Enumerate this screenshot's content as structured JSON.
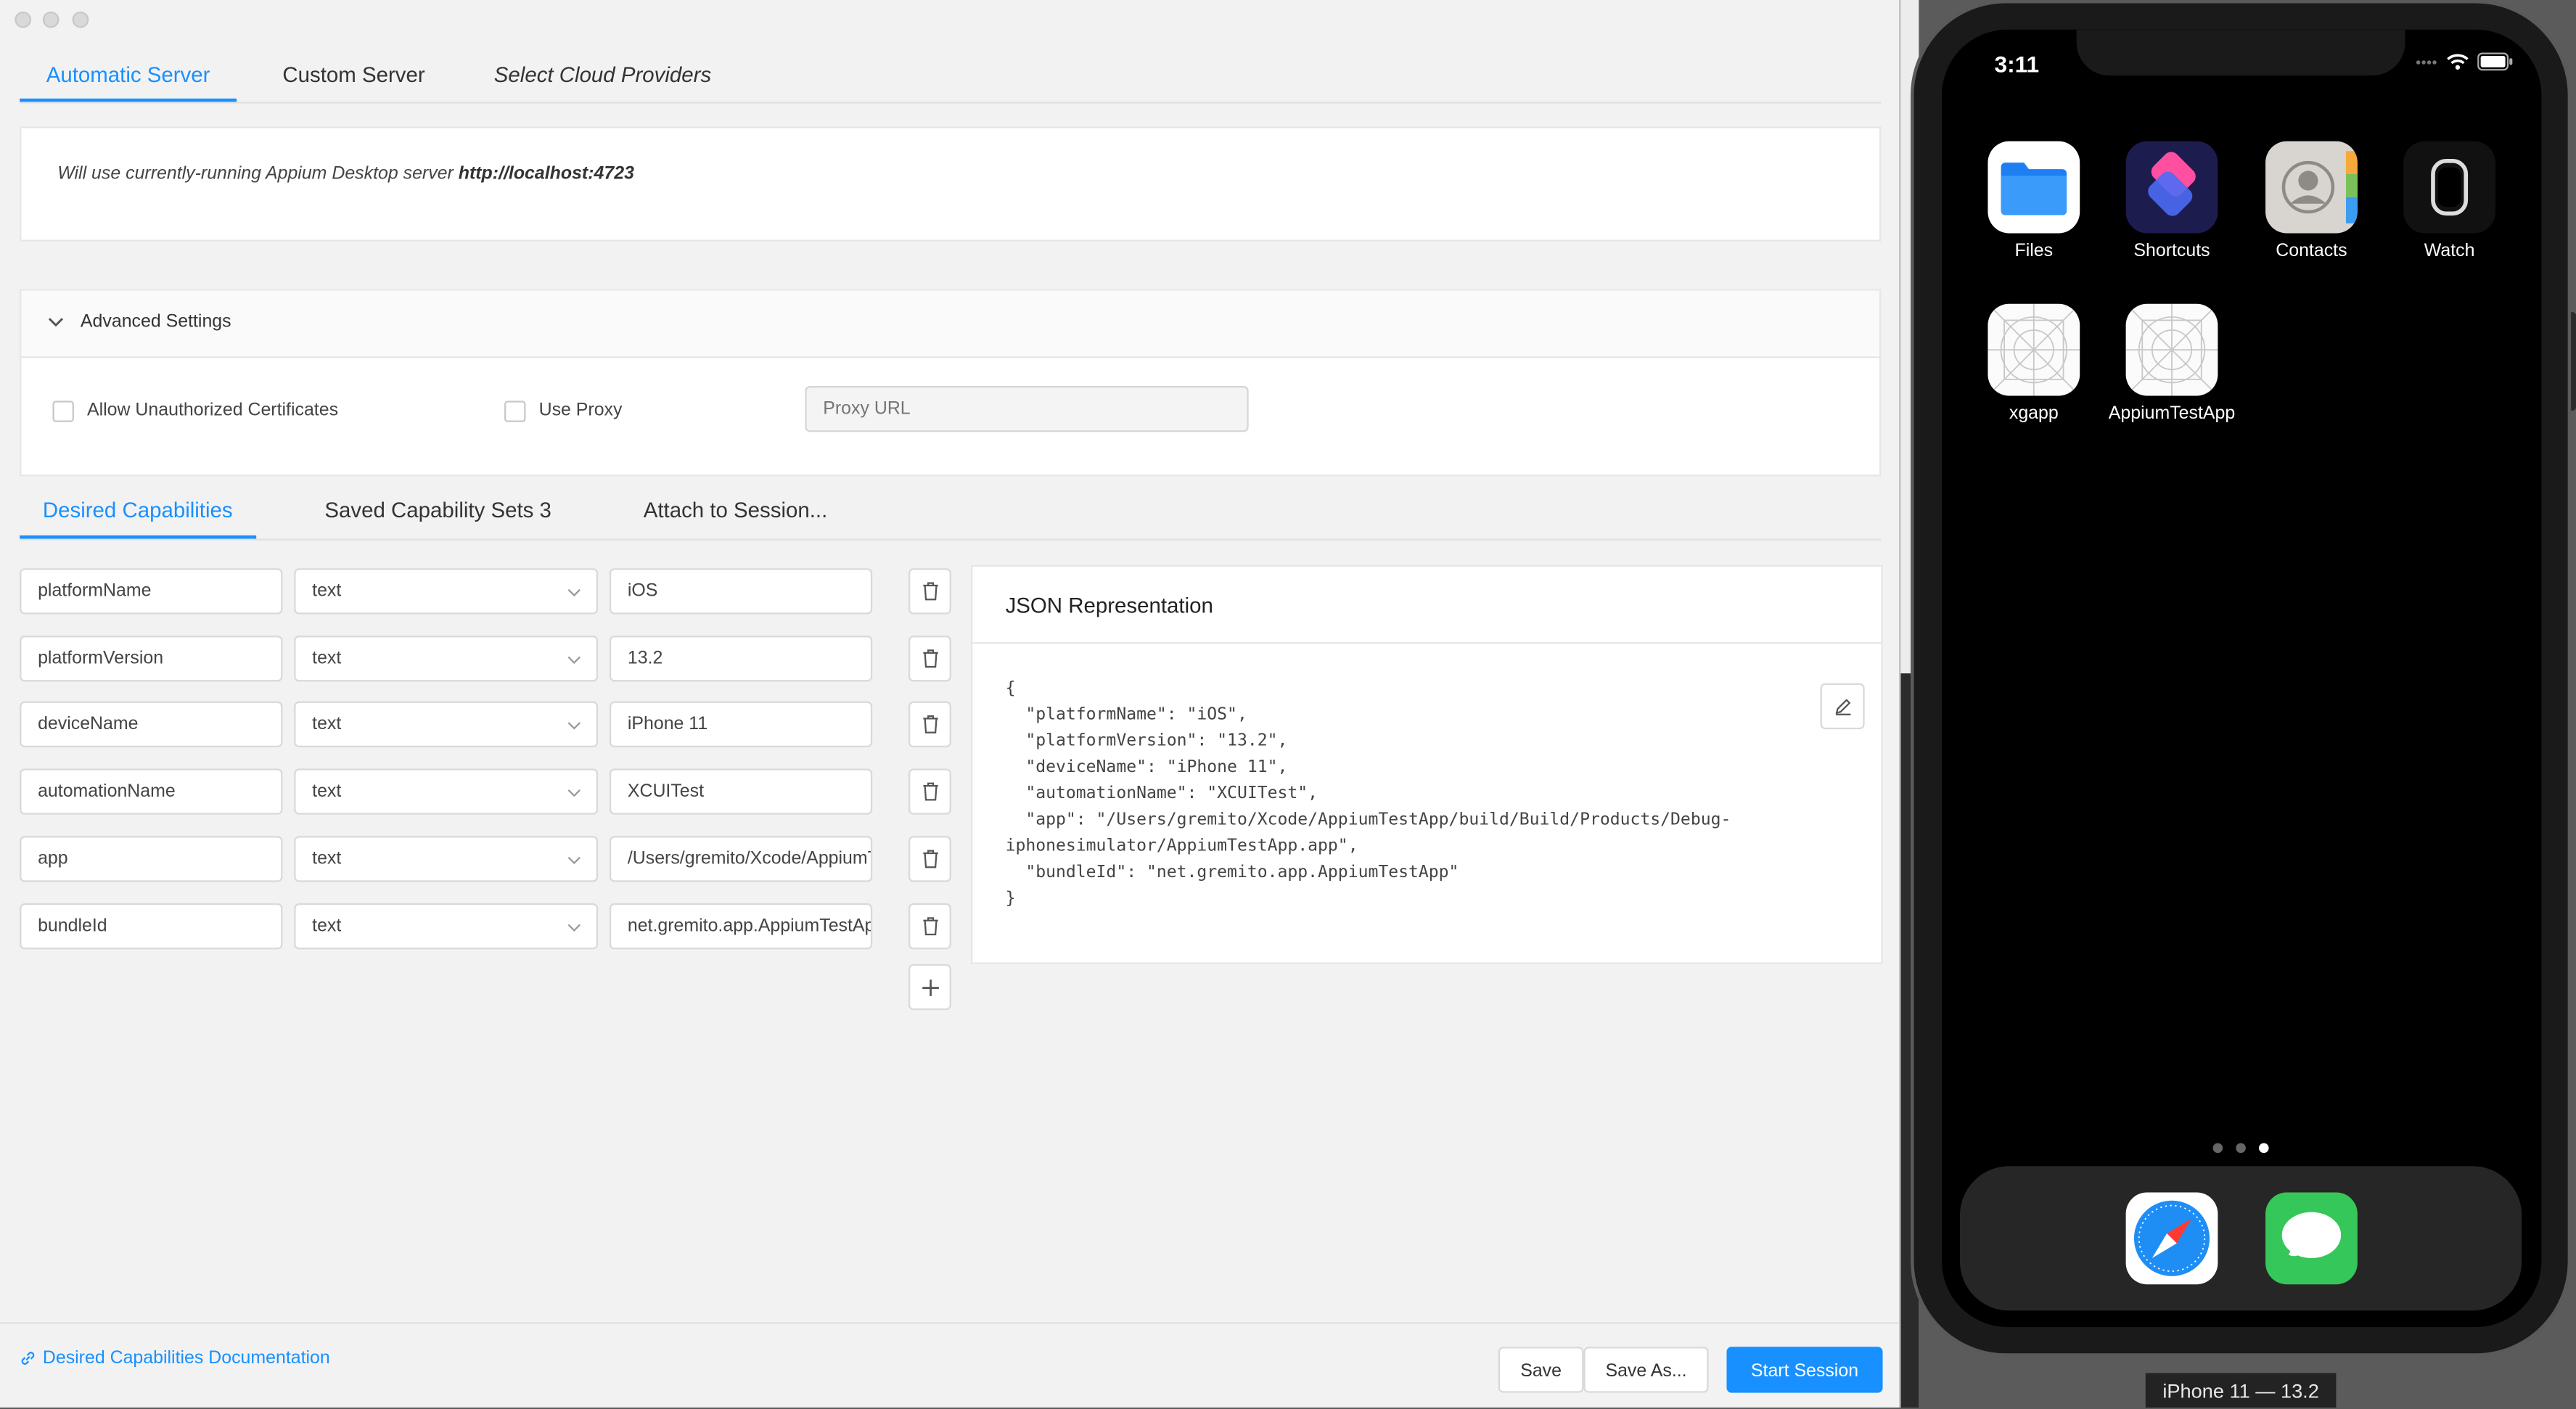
{
  "server_tabs": [
    {
      "label": "Automatic Server",
      "active": true
    },
    {
      "label": "Custom Server",
      "active": false
    },
    {
      "label": "Select Cloud Providers",
      "active": false
    }
  ],
  "server": {
    "prefix": "Will use currently-running Appium Desktop server",
    "url": "http://localhost:4723"
  },
  "advanced": {
    "title": "Advanced Settings",
    "allow_unauthorized": "Allow Unauthorized Certificates",
    "use_proxy": "Use Proxy",
    "proxy_placeholder": "Proxy URL"
  },
  "cap_tabs": [
    {
      "label": "Desired Capabilities",
      "active": true
    },
    {
      "label": "Saved Capability Sets 3",
      "active": false
    },
    {
      "label": "Attach to Session...",
      "active": false
    }
  ],
  "capabilities": [
    {
      "name": "platformName",
      "type": "text",
      "value": "iOS"
    },
    {
      "name": "platformVersion",
      "type": "text",
      "value": "13.2"
    },
    {
      "name": "deviceName",
      "type": "text",
      "value": "iPhone 11"
    },
    {
      "name": "automationName",
      "type": "text",
      "value": "XCUITest"
    },
    {
      "name": "app",
      "type": "text",
      "value": "/Users/gremito/Xcode/AppiumTestApp/build/Build/Products/Debug-iphonesimulator/AppiumTestApp.app"
    },
    {
      "name": "bundleId",
      "type": "text",
      "value": "net.gremito.app.AppiumTestApp"
    }
  ],
  "json_panel": {
    "title": "JSON Representation",
    "content": "{\n  \"platformName\": \"iOS\",\n  \"platformVersion\": \"13.2\",\n  \"deviceName\": \"iPhone 11\",\n  \"automationName\": \"XCUITest\",\n  \"app\": \"/Users/gremito/Xcode/AppiumTestApp/build/Build/Products/Debug-\niphonesimulator/AppiumTestApp.app\",\n  \"bundleId\": \"net.gremito.app.AppiumTestApp\"\n}"
  },
  "footer": {
    "docs_link": "Desired Capabilities Documentation",
    "save": "Save",
    "save_as": "Save As...",
    "start": "Start Session"
  },
  "colors": {
    "accent": "#1890ff"
  },
  "simulator": {
    "time": "3:11",
    "caption": "iPhone 11 — 13.2",
    "apps": [
      {
        "label": "Files",
        "icon": "files-icon"
      },
      {
        "label": "Shortcuts",
        "icon": "shortcuts-icon"
      },
      {
        "label": "Contacts",
        "icon": "contacts-icon"
      },
      {
        "label": "Watch",
        "icon": "watch-icon"
      },
      {
        "label": "xgapp",
        "icon": "placeholder-app-icon"
      },
      {
        "label": "AppiumTestApp",
        "icon": "placeholder-app-icon"
      }
    ],
    "dock": [
      {
        "icon": "safari-icon"
      },
      {
        "icon": "messages-icon"
      }
    ],
    "page_dots": 3,
    "active_dot": 3
  }
}
